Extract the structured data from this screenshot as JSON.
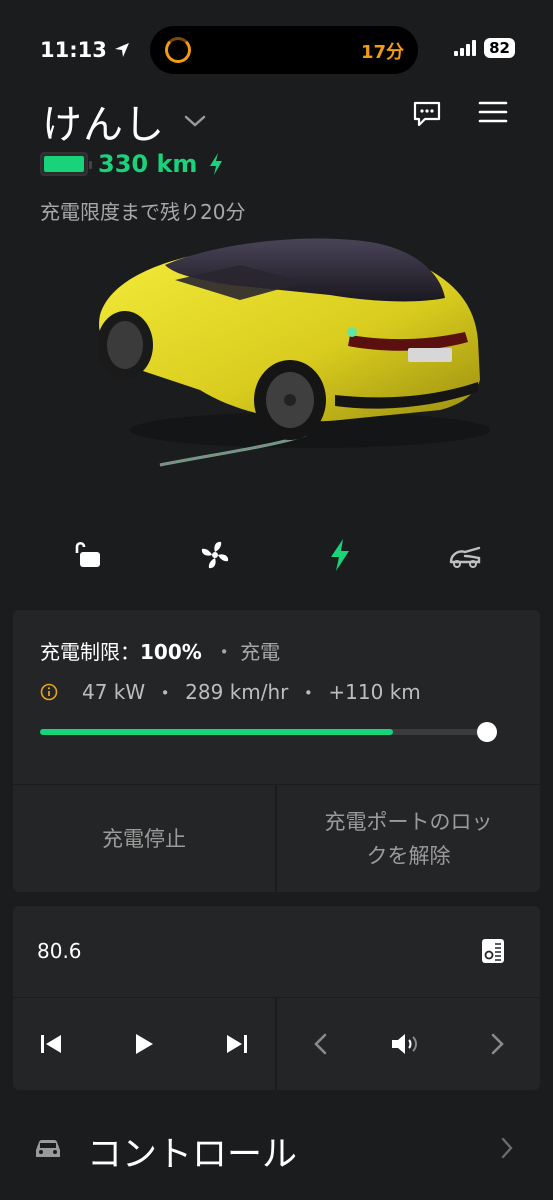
{
  "status_bar": {
    "time": "11:13",
    "timer_text": "17分",
    "battery_percent": "82"
  },
  "header": {
    "vehicle_name": "けんし",
    "range": "330 km",
    "charge_time_remaining": "充電限度まで残り20分",
    "battery_fill": 1.0
  },
  "quick_actions": [
    "unlock-icon",
    "fan-icon",
    "charge-bolt-icon",
    "trunk-icon"
  ],
  "charging": {
    "limit_label": "充電制限：",
    "limit_value": "100%",
    "separator": "・",
    "state": "充電",
    "power": "47 kW",
    "speed": "289 km/hr",
    "added": "+110 km",
    "progress": 0.78,
    "stop_button": "充電停止",
    "unlock_port_line1": "充電ポートのロッ",
    "unlock_port_line2": "クを解除"
  },
  "media": {
    "station": "80.6"
  },
  "controls": {
    "label": "コントロール"
  },
  "colors": {
    "accent_green": "#19d37a",
    "timer_orange": "#f39c12",
    "background": "#1b1c1e",
    "panel": "#242527"
  }
}
